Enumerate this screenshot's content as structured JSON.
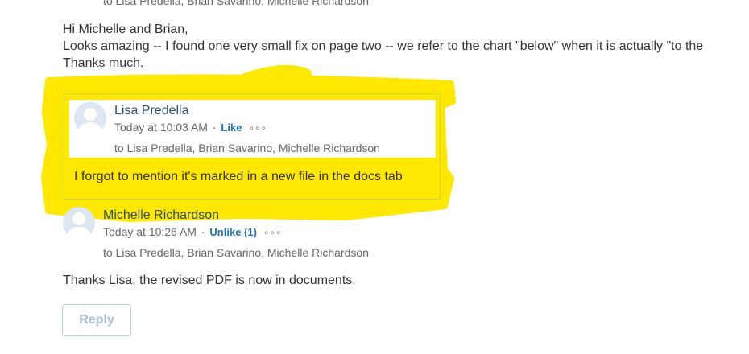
{
  "top_recipients": "to Lisa Predella, Brian Savarino, Michelle Richardson",
  "message1": {
    "greeting": "Hi Michelle and Brian,",
    "line1": "Looks amazing -- I found one very small fix on page two -- we refer to the chart \"below\" when it is actually \"to the",
    "line2": "Thanks much."
  },
  "quoted_reply": {
    "author": "Lisa Predella",
    "time": "Today at 10:03 AM",
    "separator": "·",
    "like_label": "Like",
    "more_glyph": "∘∘∘",
    "recipients": "to Lisa Predella, Brian Savarino, Michelle Richardson",
    "body": "I forgot to mention it's marked in a new file in the docs tab"
  },
  "reply2": {
    "author": "Michelle Richardson",
    "time": "Today at 10:26 AM",
    "separator": "·",
    "unlike_label": "Unlike (1)",
    "more_glyph": "∘∘∘",
    "recipients": "to Lisa Predella, Brian Savarino, Michelle Richardson",
    "body": "Thanks Lisa, the revised PDF is now in documents."
  },
  "reply_button_label": "Reply",
  "colors": {
    "highlight": "#ffe800",
    "link": "#1f73b7",
    "author": "#2a4f74"
  }
}
